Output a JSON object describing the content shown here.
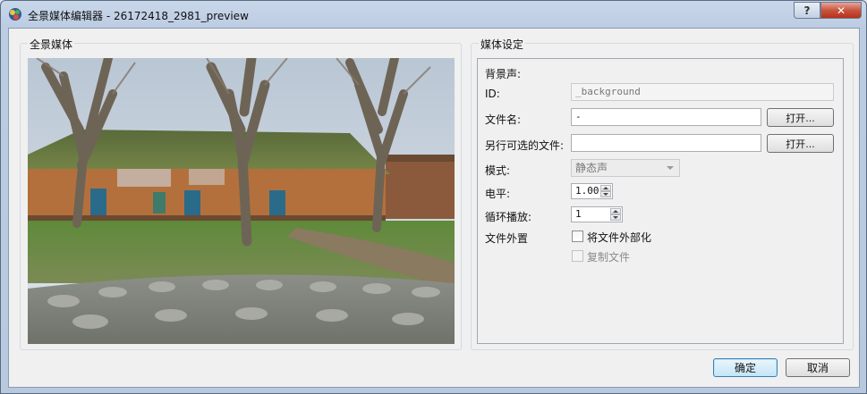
{
  "window": {
    "title": "全景媒体编辑器 - 26172418_2981_preview",
    "help_label": "?",
    "close_label": "✕"
  },
  "media": {
    "group_label": "全景媒体"
  },
  "settings": {
    "group_label": "媒体设定",
    "section_label": "背景声:",
    "id_label": "ID:",
    "id_value": "_background",
    "filename_label": "文件名:",
    "filename_value": "-",
    "browse_label": "打开...",
    "alt_file_label": "另行可选的文件:",
    "alt_file_value": "",
    "browse2_label": "打开...",
    "mode_label": "模式:",
    "mode_value": "静态声",
    "level_label": "电平:",
    "level_value": "1.00",
    "loop_label": "循环播放:",
    "loop_value": "1",
    "external_label": "文件外置",
    "externalize_label": "将文件外部化",
    "copy_file_label": "复制文件"
  },
  "footer": {
    "ok_label": "确定",
    "cancel_label": "取消"
  }
}
